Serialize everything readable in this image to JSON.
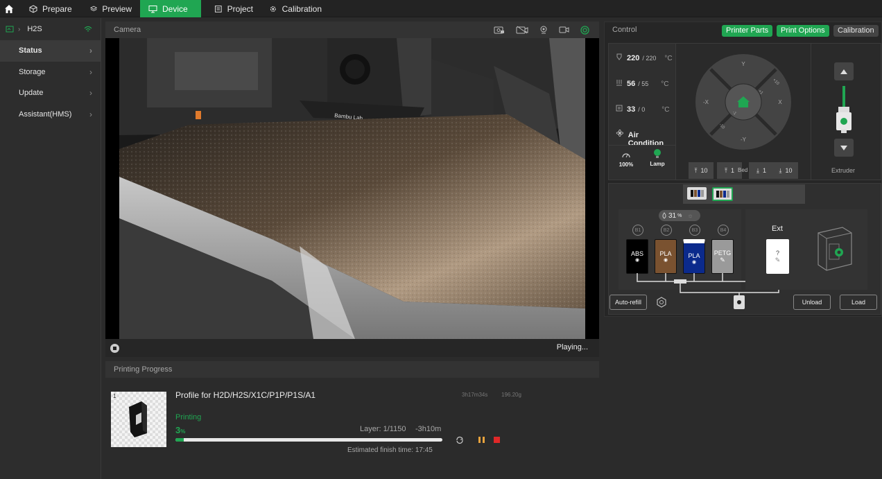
{
  "tabs": [
    {
      "label": "Prepare",
      "icon": "cube-icon"
    },
    {
      "label": "Preview",
      "icon": "layers-icon"
    },
    {
      "label": "Device",
      "icon": "device-icon"
    },
    {
      "label": "Project",
      "icon": "project-icon"
    },
    {
      "label": "Calibration",
      "icon": "gear-icon"
    }
  ],
  "sidebar": {
    "device_name": "H2S",
    "items": [
      {
        "label": "Status"
      },
      {
        "label": "Storage"
      },
      {
        "label": "Update"
      },
      {
        "label": "Assistant(HMS)"
      }
    ]
  },
  "camera": {
    "title": "Camera",
    "status": "Playing...",
    "overlay_brand": "Bambu Lab"
  },
  "progress": {
    "title": "Printing Progress",
    "thumbnail_index": "1",
    "job_name": "Profile for H2D/H2S/X1C/P1P/P1S/A1",
    "print_time": "3h17m34s",
    "weight": "196.20g",
    "state": "Printing",
    "percent": "3",
    "percent_unit": "%",
    "percent_value": 3,
    "layer": "Layer: 1/1150",
    "remaining": "-3h10m",
    "finish": "Estimated finish time: 17:45"
  },
  "control": {
    "title": "Control",
    "buttons": {
      "printer_parts": "Printer Parts",
      "print_options": "Print Options",
      "calibration": "Calibration"
    },
    "nozzle": {
      "current": "220",
      "target": "/ 220",
      "unit": "°C"
    },
    "bed": {
      "current": "56",
      "target": "/ 55",
      "unit": "°C"
    },
    "chamber": {
      "current": "33",
      "target": "/ 0",
      "unit": "°C"
    },
    "air_condition": "Air Condition",
    "fan": "100%",
    "lamp": "Lamp",
    "jog": {
      "y_plus": "Y",
      "y_minus": "-Y",
      "x_plus": "X",
      "x_minus": "-X",
      "p10": "+10",
      "p1": "+1",
      "m1": "-1",
      "m10": "-10"
    },
    "bed_label": "Bed",
    "bed_buttons": [
      "10",
      "1",
      "1",
      "10"
    ],
    "extruder": "Extruder"
  },
  "ams": {
    "humidity": "31",
    "humidity_unit": "%",
    "slots": [
      {
        "label": "B1",
        "material": "ABS",
        "color": "#000000",
        "text": "#ffffff"
      },
      {
        "label": "B2",
        "material": "PLA",
        "color": "#7a5230",
        "text": "#ffffff"
      },
      {
        "label": "B3",
        "material": "PLA",
        "color": "#0b2a8c",
        "text": "#ffffff"
      },
      {
        "label": "B4",
        "material": "PETG",
        "color": "#9a9a9a",
        "text": "#ffffff"
      }
    ],
    "ext_label": "Ext",
    "ext_slot": "?",
    "auto_refill": "Auto-refill",
    "unload": "Unload",
    "load": "Load"
  },
  "colors": {
    "accent": "#20a652",
    "pause": "#e8a33d",
    "stop": "#e02828"
  }
}
